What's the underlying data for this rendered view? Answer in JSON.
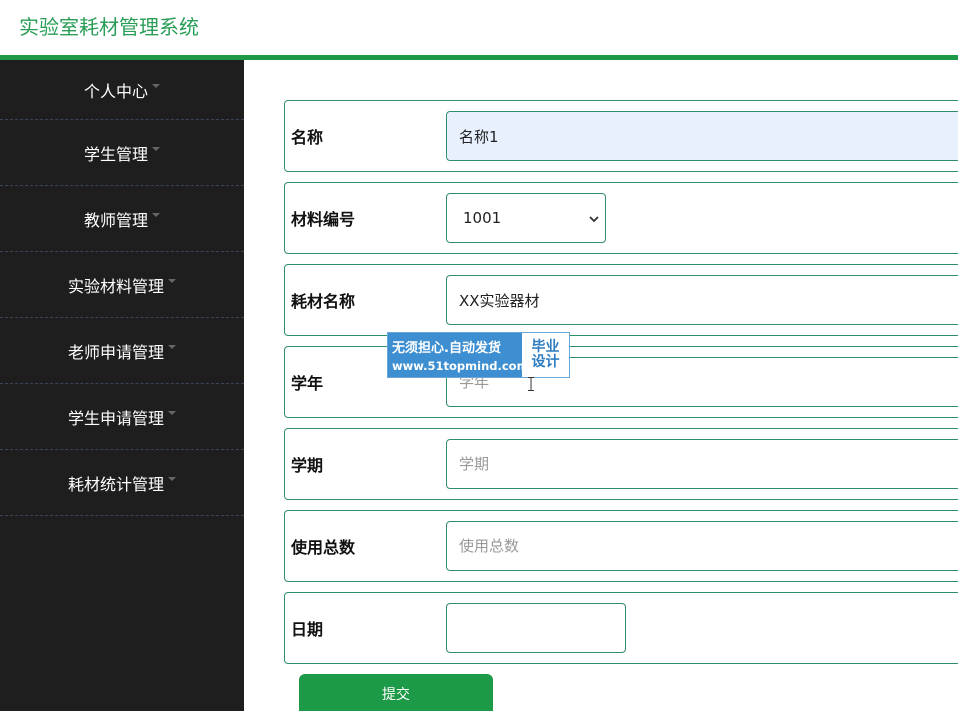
{
  "app": {
    "title": "实验室耗材管理系统"
  },
  "colors": {
    "accent": "#1d9a48",
    "sidebar_bg": "#1e1e1e",
    "border": "#2f8f6b",
    "title": "#2a9d57"
  },
  "sidebar": {
    "items": [
      {
        "label": "个人中心"
      },
      {
        "label": "学生管理"
      },
      {
        "label": "教师管理"
      },
      {
        "label": "实验材料管理"
      },
      {
        "label": "老师申请管理"
      },
      {
        "label": "学生申请管理"
      },
      {
        "label": "耗材统计管理"
      }
    ]
  },
  "form": {
    "name": {
      "label": "名称",
      "value": "名称1"
    },
    "material_code": {
      "label": "材料编号",
      "value": "1001"
    },
    "consumable_name": {
      "label": "耗材名称",
      "value": "XX实验器材"
    },
    "school_year": {
      "label": "学年",
      "placeholder": "学年"
    },
    "semester": {
      "label": "学期",
      "placeholder": "学期"
    },
    "total_used": {
      "label": "使用总数",
      "placeholder": "使用总数"
    },
    "date": {
      "label": "日期",
      "value": ""
    },
    "submit_label": "提交"
  },
  "watermark": {
    "slogan": "无须担心.自动发货",
    "url": "www.51topmind.com",
    "tag_line1": "毕业",
    "tag_line2": "设计"
  }
}
